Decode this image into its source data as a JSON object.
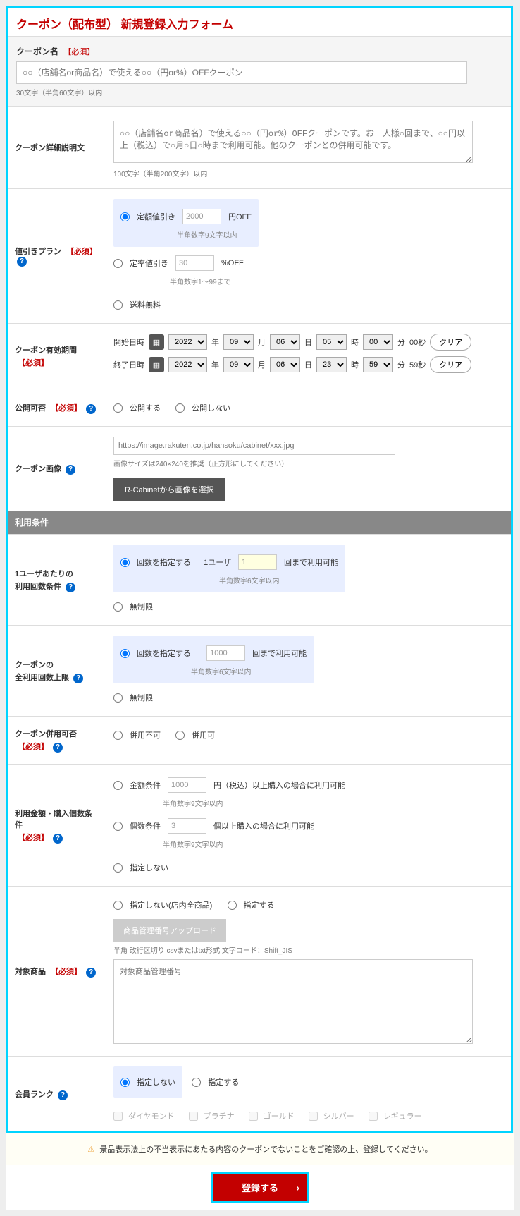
{
  "page_title": "クーポン（配布型） 新規登録入力フォーム",
  "required_label": "【必須】",
  "coupon_name": {
    "label": "クーポン名",
    "placeholder": "○○（店舗名or商品名）で使える○○（円or%）OFFクーポン",
    "hint": "30文字（半角60文字）以内"
  },
  "description": {
    "label": "クーポン詳細説明文",
    "placeholder": "○○（店舗名or商品名）で使える○○（円or%）OFFクーポンです。お一人様○回まで、○○円以上（税込）で○月○日○時まで利用可能。他のクーポンとの併用可能です。",
    "hint": "100文字（半角200文字）以内"
  },
  "discount": {
    "label": "値引きプラン",
    "fixed_label": "定額値引き",
    "fixed_value": "2000",
    "fixed_unit": "円OFF",
    "fixed_hint": "半角数字9文字以内",
    "rate_label": "定率値引き",
    "rate_value": "30",
    "rate_unit": "%OFF",
    "rate_hint": "半角数字1～99まで",
    "free_ship": "送料無料"
  },
  "period": {
    "label": "クーポン有効期間",
    "start_label": "開始日時",
    "end_label": "終了日時",
    "year": "2022",
    "month": "09",
    "day": "06",
    "start_hour": "05",
    "start_min": "00",
    "start_sec": "00秒",
    "end_hour": "23",
    "end_min": "59",
    "end_sec": "59秒",
    "y": "年",
    "m": "月",
    "d": "日",
    "h": "時",
    "mi": "分",
    "clear": "クリア"
  },
  "publish": {
    "label": "公開可否",
    "yes": "公開する",
    "no": "公開しない"
  },
  "image": {
    "label": "クーポン画像",
    "placeholder": "https://image.rakuten.co.jp/hansoku/cabinet/xxx.jpg",
    "hint": "画像サイズは240×240を推奨（正方形にしてください）",
    "cabinet_btn": "R-Cabinetから画像を選択"
  },
  "conditions_header": "利用条件",
  "per_user": {
    "label1": "1ユーザあたりの",
    "label2": "利用回数条件",
    "specify": "回数を指定する",
    "prefix": "1ユーザ",
    "value": "1",
    "suffix": "回まで利用可能",
    "hint": "半角数字6文字以内",
    "unlimited": "無制限"
  },
  "total_use": {
    "label1": "クーポンの",
    "label2": "全利用回数上限",
    "specify": "回数を指定する",
    "value": "1000",
    "suffix": "回まで利用可能",
    "hint": "半角数字6文字以内",
    "unlimited": "無制限"
  },
  "combine": {
    "label": "クーポン併用可否",
    "no": "併用不可",
    "yes": "併用可"
  },
  "amount_cond": {
    "label": "利用金額・購入個数条件",
    "amount_label": "金額条件",
    "amount_value": "1000",
    "amount_suffix": "円（税込）以上購入の場合に利用可能",
    "amount_hint": "半角数字9文字以内",
    "qty_label": "個数条件",
    "qty_value": "3",
    "qty_suffix": "個以上購入の場合に利用可能",
    "qty_hint": "半角数字9文字以内",
    "none": "指定しない"
  },
  "target": {
    "label": "対象商品",
    "none": "指定しない(店内全商品)",
    "specify": "指定する",
    "upload_btn": "商品管理番号アップロード",
    "upload_hint": "半角 改行区切り csvまたはtxt形式 文字コード：Shift_JIS",
    "placeholder": "対象商品管理番号"
  },
  "rank": {
    "label": "会員ランク",
    "none": "指定しない",
    "specify": "指定する",
    "ranks": [
      "ダイヤモンド",
      "プラチナ",
      "ゴールド",
      "シルバー",
      "レギュラー"
    ]
  },
  "warning": "景品表示法上の不当表示にあたる内容のクーポンでないことをご確認の上、登録してください。",
  "submit": "登録する"
}
